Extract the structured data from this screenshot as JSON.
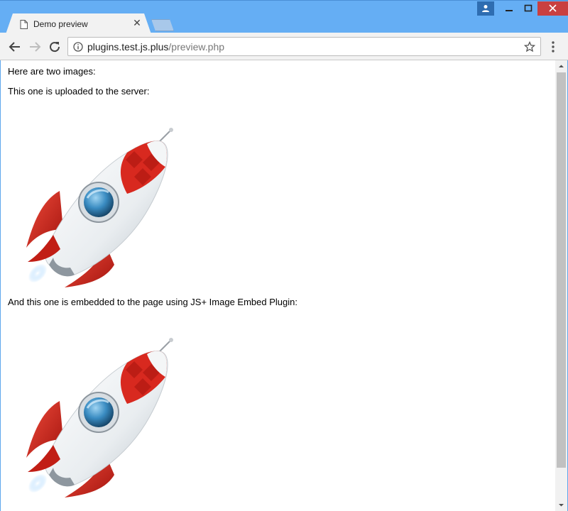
{
  "browser": {
    "tab": {
      "title": "Demo preview",
      "close_glyph": "✕",
      "icon": "document-icon"
    },
    "window_controls": {
      "user": "user-icon",
      "minimize": "minimize-icon",
      "maximize": "maximize-icon",
      "close": "close-icon"
    },
    "address_bar": {
      "domain": "plugins.test.js.plus",
      "path": "/preview.php"
    }
  },
  "page": {
    "intro": "Here are two images:",
    "uploaded_caption": "This one is uploaded to the server:",
    "embedded_caption": "And this one is embedded to the page using JS+ Image Embed Plugin:",
    "image_subject": "rocket-image"
  },
  "colors": {
    "titlebar": "#65aef4",
    "close_button": "#c94040",
    "rocket_red": "#d8291f",
    "porthole_blue": "#3a8cc2"
  }
}
